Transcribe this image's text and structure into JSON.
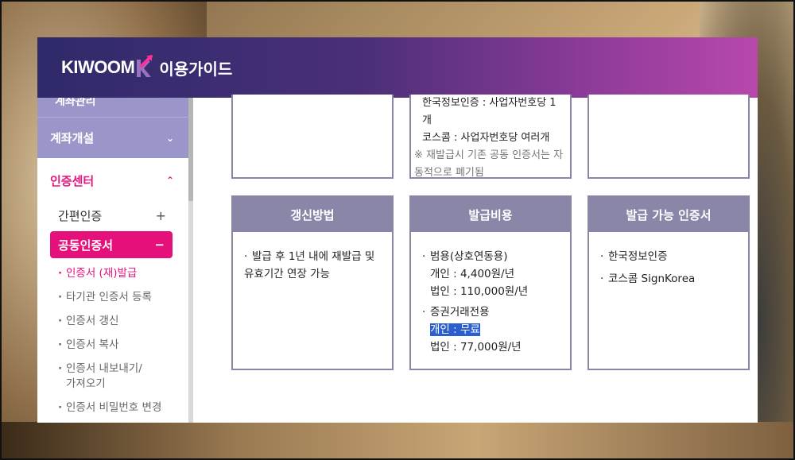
{
  "header": {
    "brand": "KIWOOM",
    "guide": "이용가이드",
    "colors": {
      "start": "#2e2a6a",
      "end": "#b848ac",
      "accent": "#e6107b"
    }
  },
  "sidebar": {
    "cut_label": "계좌관리",
    "sections": [
      {
        "label": "계좌개설",
        "chevron": "chevron-down-icon"
      },
      {
        "label": "인증센터",
        "chevron": "chevron-up-icon"
      }
    ],
    "items": [
      {
        "label": "간편인증",
        "toggle": "+"
      },
      {
        "label": "공동인증서",
        "toggle": "−"
      }
    ],
    "sub_items": [
      "인증서 (재)발급",
      "타기관 인증서 등록",
      "인증서 갱신",
      "인증서 복사",
      "인증서 내보내기/\n가져오기",
      "인증서 비밀번호 변경"
    ]
  },
  "top_cards": {
    "middle_lines": [
      "한국정보인증 : 사업자번호당 1개",
      "코스콤 : 사업자번호당 여러개",
      "※ 재발급시 기존 공동 인증서는 자동적으로 폐기됨"
    ]
  },
  "cards": [
    {
      "title": "갱신방법",
      "lines": [
        "발급 후 1년 내에 재발급 및 유효기간 연장 가능"
      ]
    },
    {
      "title": "발급비용",
      "groups": [
        {
          "label": "범용(상호연동용)",
          "lines": [
            "개인 : 4,400원/년",
            "법인 : 110,000원/년"
          ]
        },
        {
          "label": "증권거래전용",
          "lines": [
            "개인 : 무료",
            "법인 : 77,000원/년"
          ]
        }
      ]
    },
    {
      "title": "발급 가능 인증서",
      "lines": [
        "한국정보인증",
        "코스콤 SignKorea"
      ]
    }
  ]
}
